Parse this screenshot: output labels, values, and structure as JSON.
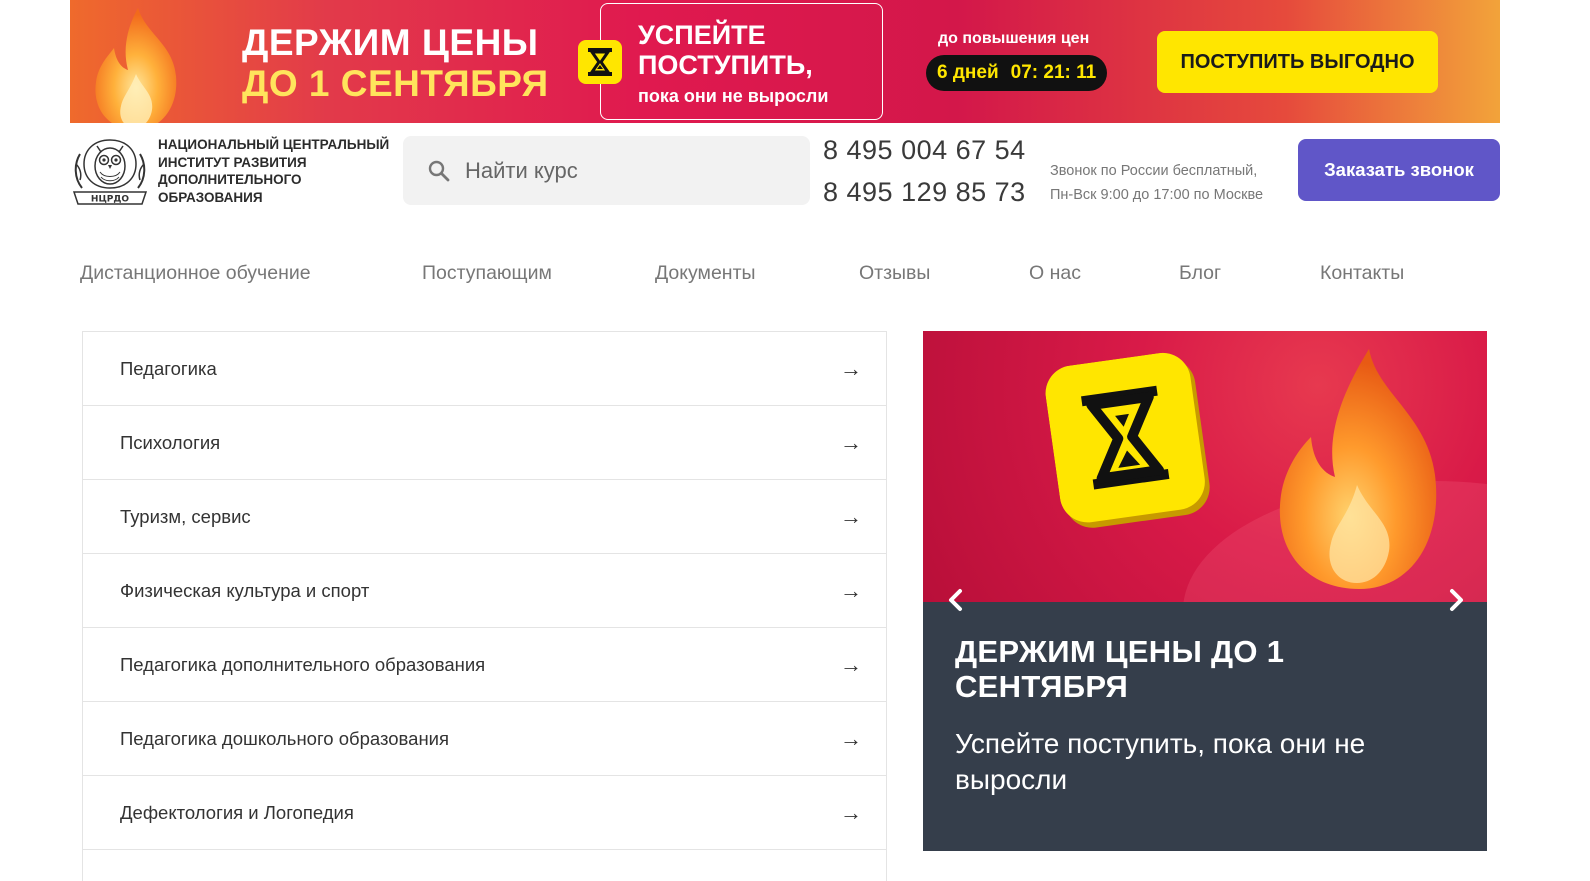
{
  "promo": {
    "title_line1": "ДЕРЖИМ ЦЕНЫ",
    "title_line2": "ДО 1 СЕНТЯБРЯ",
    "box_line1": "УСПЕЙТЕ",
    "box_line2": "ПОСТУПИТЬ,",
    "box_small": "пока они не выросли",
    "countdown_label": "до повышения цен",
    "countdown_days": "6 дней",
    "countdown_time": "07: 21: 11",
    "cta_label": "ПОСТУПИТЬ ВЫГОДНО",
    "icons": [
      "flame-icon",
      "hourglass-icon"
    ],
    "colors": {
      "accent_yellow": "#ffe600",
      "banner_red": "#e0194f"
    }
  },
  "header": {
    "logo_text": "Национальный центральный институт развития дополнительного образования",
    "logo_emblem_text": "НЦРДО",
    "search_placeholder": "Найти курс",
    "phone1": "8 495 004 67 54",
    "phone2": "8 495 129 85 73",
    "hours_line1": "Звонок по России бесплатный,",
    "hours_line2": "Пн-Вск 9:00 до 17:00 по Москве",
    "call_button": "Заказать звонок",
    "colors": {
      "call_button": "#6056c8"
    }
  },
  "nav": {
    "items": [
      {
        "label": "Дистанционное обучение"
      },
      {
        "label": "Поступающим"
      },
      {
        "label": "Документы"
      },
      {
        "label": "Отзывы"
      },
      {
        "label": "О нас"
      },
      {
        "label": "Блог"
      },
      {
        "label": "Контакты"
      }
    ]
  },
  "categories": {
    "arrow": "→",
    "items": [
      {
        "label": "Педагогика"
      },
      {
        "label": "Психология"
      },
      {
        "label": "Туризм, сервис"
      },
      {
        "label": "Физическая культура и спорт"
      },
      {
        "label": "Педагогика дополнительного образования"
      },
      {
        "label": "Педагогика дошкольного образования"
      },
      {
        "label": "Дефектология и Логопедия"
      }
    ]
  },
  "slider": {
    "title": "ДЕРЖИМ ЦЕНЫ ДО 1 СЕНТЯБРЯ",
    "subtitle": "Успейте поступить, пока они не выросли",
    "icons": [
      "chevron-left-icon",
      "chevron-right-icon"
    ],
    "colors": {
      "caption_bg": "#353e4b"
    }
  }
}
